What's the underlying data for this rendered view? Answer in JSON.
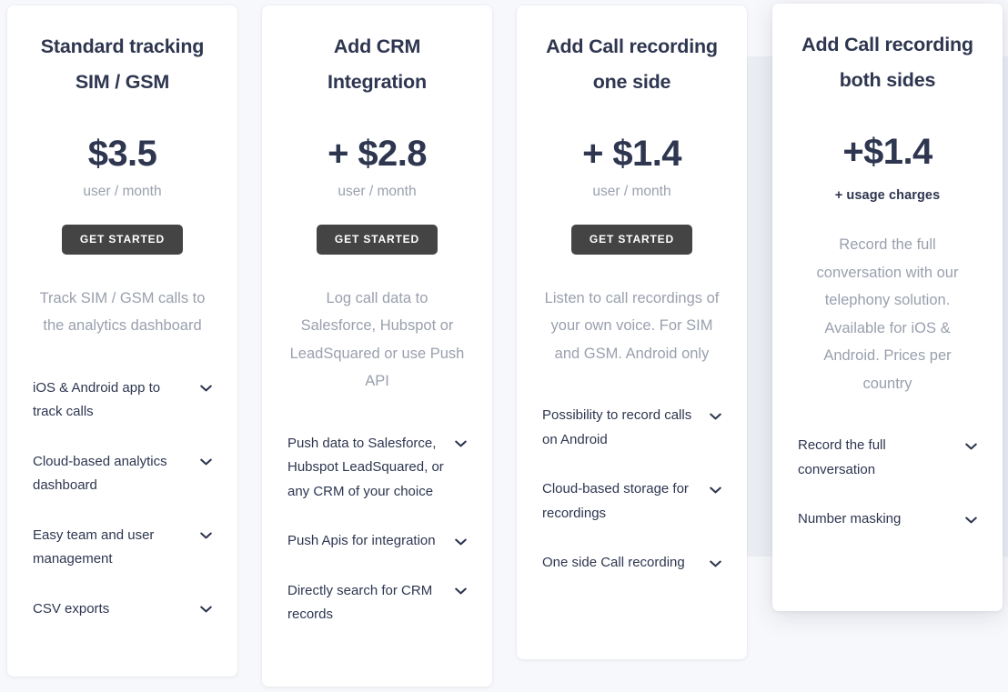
{
  "page": {
    "background_color": "#f7f8fb",
    "card_background": "#ffffff",
    "title_color": "#2e3650",
    "muted_text_color": "#9aa0ae",
    "cta_background": "#444444",
    "cta_text_color": "#ffffff",
    "highlight_slab_color": "#eceef4"
  },
  "icons": {
    "chevron_down": "chevron-down-icon"
  },
  "cards": [
    {
      "title_line_1": "Standard tracking",
      "title_line_2": "SIM / GSM",
      "price": "$3.5",
      "price_unit": "user / month",
      "cta_label": "GET STARTED",
      "has_cta": true,
      "blurb": "Track SIM / GSM calls to the analytics dashboard",
      "features": [
        "iOS & Android app to track calls",
        "Cloud-based analytics dashboard",
        "Easy team and user management",
        "CSV exports"
      ]
    },
    {
      "title_line_1": "Add CRM",
      "title_line_2": "Integration",
      "price": "+ $2.8",
      "price_unit": "user / month",
      "cta_label": "GET STARTED",
      "has_cta": true,
      "blurb": "Log call data to Salesforce, Hubspot or LeadSquared or use Push API",
      "features": [
        "Push data to Salesforce, Hubspot LeadSquared, or any CRM of your choice",
        "Push Apis for integration",
        "Directly search for CRM records"
      ]
    },
    {
      "title_line_1": "Add Call recording",
      "title_line_2": "one side",
      "price": "+ $1.4",
      "price_unit": "user / month",
      "cta_label": "GET STARTED",
      "has_cta": true,
      "blurb": "Listen to call recordings of your own voice. For SIM and GSM. Android only",
      "features": [
        "Possibility to record calls on Android",
        "Cloud-based storage for recordings",
        "One side Call recording"
      ]
    },
    {
      "title_line_1": "Add Call recording",
      "title_line_2": "both sides",
      "price": "+$1.4",
      "price_unit": "+  usage charges",
      "cta_label": "",
      "has_cta": false,
      "blurb": "Record the full conversation with our telephony solution. Available for iOS & Android. Prices per country",
      "features": [
        "Record the full conversation",
        "Number masking"
      ]
    }
  ]
}
